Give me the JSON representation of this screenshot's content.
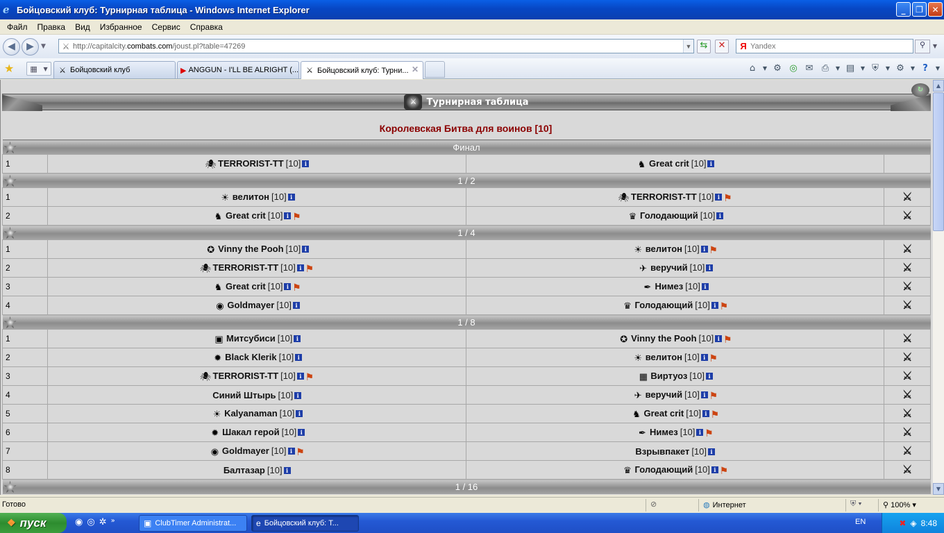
{
  "window": {
    "title": "Бойцовский клуб: Турнирная таблица - Windows Internet Explorer"
  },
  "menu": [
    "Файл",
    "Правка",
    "Вид",
    "Избранное",
    "Сервис",
    "Справка"
  ],
  "address": {
    "url_prefix": "http://capitalcity.",
    "url_domain": "combats.com",
    "url_path": "/joust.pl?table=47269"
  },
  "search": {
    "placeholder": "Yandex",
    "provider_glyph": "Я"
  },
  "tabs": [
    {
      "label": "Бойцовский клуб",
      "active": false
    },
    {
      "label": "ANGGUN - I'LL BE ALRIGHT (...",
      "active": false
    },
    {
      "label": "Бойцовский клуб: Турни...",
      "active": true
    }
  ],
  "page": {
    "banner_title": "Турнирная таблица",
    "subtitle": "Королевская Битва для воинов [10]"
  },
  "rounds": [
    {
      "name": "Финал",
      "matches": [
        {
          "n": "1",
          "left": {
            "name": "TERRORIST-TT",
            "lvl": "[10]",
            "icon": "🕷",
            "flag": false
          },
          "right": {
            "name": "Great crit",
            "lvl": "[10]",
            "icon": "♞",
            "flag": false
          },
          "swords": false
        }
      ]
    },
    {
      "name": "1 / 2",
      "matches": [
        {
          "n": "1",
          "left": {
            "name": "велитон",
            "lvl": "[10]",
            "icon": "☀",
            "flag": false
          },
          "right": {
            "name": "TERRORIST-TT",
            "lvl": "[10]",
            "icon": "🕷",
            "flag": true
          },
          "swords": true
        },
        {
          "n": "2",
          "left": {
            "name": "Great crit",
            "lvl": "[10]",
            "icon": "♞",
            "flag": true
          },
          "right": {
            "name": "Голодающий",
            "lvl": "[10]",
            "icon": "♛",
            "flag": false
          },
          "swords": true
        }
      ]
    },
    {
      "name": "1 / 4",
      "matches": [
        {
          "n": "1",
          "left": {
            "name": "Vinny the Pooh",
            "lvl": "[10]",
            "icon": "✪",
            "flag": false
          },
          "right": {
            "name": "велитон",
            "lvl": "[10]",
            "icon": "☀",
            "flag": true
          },
          "swords": true
        },
        {
          "n": "2",
          "left": {
            "name": "TERRORIST-TT",
            "lvl": "[10]",
            "icon": "🕷",
            "flag": true
          },
          "right": {
            "name": "веручий",
            "lvl": "[10]",
            "icon": "✈",
            "flag": false
          },
          "swords": true
        },
        {
          "n": "3",
          "left": {
            "name": "Great crit",
            "lvl": "[10]",
            "icon": "♞",
            "flag": true
          },
          "right": {
            "name": "Нимез",
            "lvl": "[10]",
            "icon": "✒",
            "flag": false
          },
          "swords": true
        },
        {
          "n": "4",
          "left": {
            "name": "Goldmayer",
            "lvl": "[10]",
            "icon": "◉",
            "flag": false
          },
          "right": {
            "name": "Голодающий",
            "lvl": "[10]",
            "icon": "♛",
            "flag": true
          },
          "swords": true
        }
      ]
    },
    {
      "name": "1 / 8",
      "matches": [
        {
          "n": "1",
          "left": {
            "name": "Митсубиси",
            "lvl": "[10]",
            "icon": "▣",
            "flag": false
          },
          "right": {
            "name": "Vinny the Pooh",
            "lvl": "[10]",
            "icon": "✪",
            "flag": true
          },
          "swords": true
        },
        {
          "n": "2",
          "left": {
            "name": "Black Klerik",
            "lvl": "[10]",
            "icon": "✹",
            "flag": false
          },
          "right": {
            "name": "велитон",
            "lvl": "[10]",
            "icon": "☀",
            "flag": true
          },
          "swords": true
        },
        {
          "n": "3",
          "left": {
            "name": "TERRORIST-TT",
            "lvl": "[10]",
            "icon": "🕷",
            "flag": true
          },
          "right": {
            "name": "Виртуоз",
            "lvl": "[10]",
            "icon": "▦",
            "flag": false
          },
          "swords": true
        },
        {
          "n": "4",
          "left": {
            "name": "Синий Штырь",
            "lvl": "[10]",
            "icon": "",
            "flag": false
          },
          "right": {
            "name": "веручий",
            "lvl": "[10]",
            "icon": "✈",
            "flag": true
          },
          "swords": true
        },
        {
          "n": "5",
          "left": {
            "name": "Kalyanaman",
            "lvl": "[10]",
            "icon": "☀",
            "flag": false
          },
          "right": {
            "name": "Great crit",
            "lvl": "[10]",
            "icon": "♞",
            "flag": true
          },
          "swords": true
        },
        {
          "n": "6",
          "left": {
            "name": "Шакал герой",
            "lvl": "[10]",
            "icon": "✹",
            "flag": false
          },
          "right": {
            "name": "Нимез",
            "lvl": "[10]",
            "icon": "✒",
            "flag": true
          },
          "swords": true
        },
        {
          "n": "7",
          "left": {
            "name": "Goldmayer",
            "lvl": "[10]",
            "icon": "◉",
            "flag": true
          },
          "right": {
            "name": "Взрывпакет",
            "lvl": "[10]",
            "icon": "",
            "flag": false
          },
          "swords": true
        },
        {
          "n": "8",
          "left": {
            "name": "Балтазар",
            "lvl": "[10]",
            "icon": "",
            "flag": false
          },
          "right": {
            "name": "Голодающий",
            "lvl": "[10]",
            "icon": "♛",
            "flag": true
          },
          "swords": true
        }
      ]
    },
    {
      "name": "1 / 16",
      "matches": []
    }
  ],
  "status": {
    "text": "Готово",
    "zone": "Интернет",
    "zoom": "100%"
  },
  "taskbar": {
    "start": "пуск",
    "tasks": [
      "ClubTimer Administrat...",
      "Бойцовский клуб: Т..."
    ],
    "lang": "EN",
    "clock": "8:48"
  },
  "colors": {
    "subtitle": "#8b0000",
    "info_badge": "#1e3ea8",
    "titlebar": "#0747c4"
  }
}
